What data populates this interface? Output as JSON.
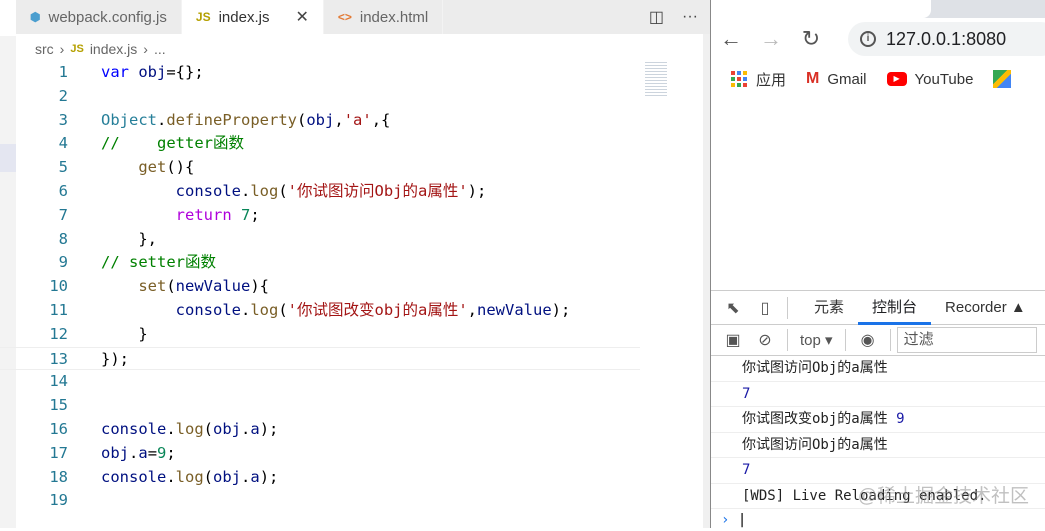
{
  "editor": {
    "tabs": [
      {
        "label": "webpack.config.js",
        "icon": "webpack-icon",
        "active": false
      },
      {
        "label": "index.js",
        "icon": "js-icon",
        "active": true
      },
      {
        "label": "index.html",
        "icon": "html-icon",
        "active": false
      }
    ],
    "js_badge": "JS",
    "html_badge": "<>",
    "breadcrumb": [
      "src",
      "index.js",
      "..."
    ],
    "lines": [
      [
        [
          "kw",
          "var"
        ],
        [
          "pl",
          " "
        ],
        [
          "var",
          "obj"
        ],
        [
          "pl",
          "={};"
        ]
      ],
      [],
      [
        [
          "cls",
          "Object"
        ],
        [
          "pl",
          "."
        ],
        [
          "fn",
          "defineProperty"
        ],
        [
          "pl",
          "("
        ],
        [
          "var",
          "obj"
        ],
        [
          "pl",
          ","
        ],
        [
          "str",
          "'a'"
        ],
        [
          "pl",
          ",{"
        ]
      ],
      [
        [
          "cm",
          "//    getter函数"
        ]
      ],
      [
        [
          "pl",
          "    "
        ],
        [
          "fn",
          "get"
        ],
        [
          "pl",
          "(){"
        ]
      ],
      [
        [
          "pl",
          "        "
        ],
        [
          "var",
          "console"
        ],
        [
          "pl",
          "."
        ],
        [
          "fn",
          "log"
        ],
        [
          "pl",
          "("
        ],
        [
          "str",
          "'你试图访问Obj的a属性'"
        ],
        [
          "pl",
          ");"
        ]
      ],
      [
        [
          "pl",
          "        "
        ],
        [
          "ctl",
          "return"
        ],
        [
          "pl",
          " "
        ],
        [
          "num",
          "7"
        ],
        [
          "pl",
          ";"
        ]
      ],
      [
        [
          "pl",
          "    },"
        ]
      ],
      [
        [
          "cm",
          "// setter函数"
        ]
      ],
      [
        [
          "pl",
          "    "
        ],
        [
          "fn",
          "set"
        ],
        [
          "pl",
          "("
        ],
        [
          "var",
          "newValue"
        ],
        [
          "pl",
          "){"
        ]
      ],
      [
        [
          "pl",
          "        "
        ],
        [
          "var",
          "console"
        ],
        [
          "pl",
          "."
        ],
        [
          "fn",
          "log"
        ],
        [
          "pl",
          "("
        ],
        [
          "str",
          "'你试图改变obj的a属性'"
        ],
        [
          "pl",
          ","
        ],
        [
          "var",
          "newValue"
        ],
        [
          "pl",
          ");"
        ]
      ],
      [
        [
          "pl",
          "    }"
        ]
      ],
      [
        [
          "pl",
          "});"
        ]
      ],
      [],
      [],
      [
        [
          "var",
          "console"
        ],
        [
          "pl",
          "."
        ],
        [
          "fn",
          "log"
        ],
        [
          "pl",
          "("
        ],
        [
          "var",
          "obj"
        ],
        [
          "pl",
          "."
        ],
        [
          "var",
          "a"
        ],
        [
          "pl",
          ");"
        ]
      ],
      [
        [
          "var",
          "obj"
        ],
        [
          "pl",
          "."
        ],
        [
          "var",
          "a"
        ],
        [
          "pl",
          "="
        ],
        [
          "num",
          "9"
        ],
        [
          "pl",
          ";"
        ]
      ],
      [
        [
          "var",
          "console"
        ],
        [
          "pl",
          "."
        ],
        [
          "fn",
          "log"
        ],
        [
          "pl",
          "("
        ],
        [
          "var",
          "obj"
        ],
        [
          "pl",
          "."
        ],
        [
          "var",
          "a"
        ],
        [
          "pl",
          ");"
        ]
      ],
      []
    ]
  },
  "browser": {
    "url": "127.0.0.1:8080",
    "bookmarks": [
      {
        "label": "应用",
        "icon": "apps-icon"
      },
      {
        "label": "Gmail",
        "icon": "gmail-icon"
      },
      {
        "label": "YouTube",
        "icon": "youtube-icon"
      }
    ],
    "devtools": {
      "tabs": [
        "元素",
        "控制台",
        "Recorder"
      ],
      "context": "top",
      "filter_placeholder": "过滤",
      "console": [
        {
          "text": "你试图访问Obj的a属性"
        },
        {
          "num": "7"
        },
        {
          "text": "你试图改变obj的a属性 ",
          "num": "9"
        },
        {
          "text": "你试图访问Obj的a属性"
        },
        {
          "num": "7"
        },
        {
          "text": "[WDS] Live Reloading enabled."
        }
      ]
    }
  },
  "watermark": "@稀土掘金技术社区"
}
